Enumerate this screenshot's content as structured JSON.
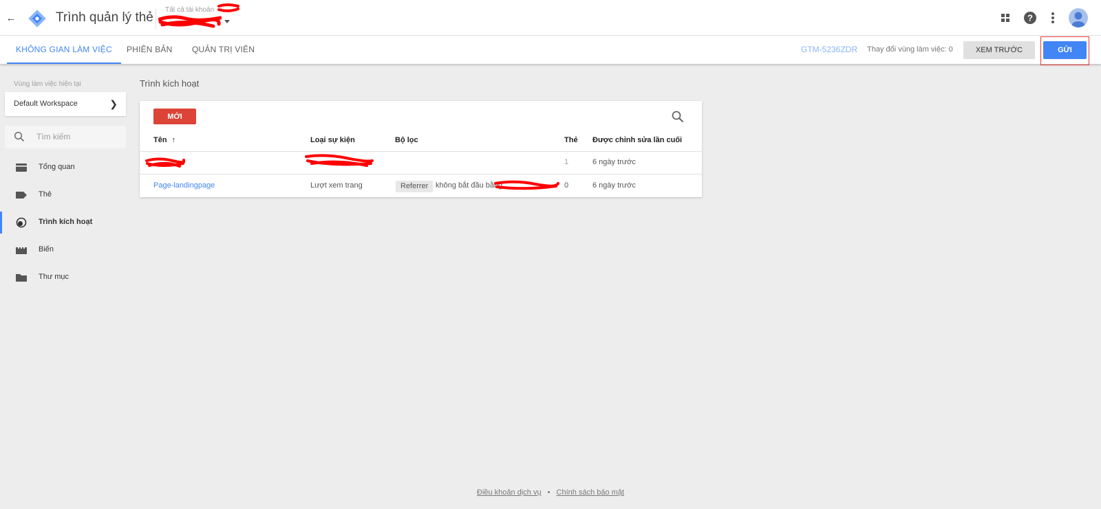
{
  "header": {
    "app_title": "Trình quản lý thẻ",
    "account_label": "Tất cả tài khoản",
    "icons": [
      "back-arrow-icon",
      "gtm-logo-icon",
      "apps-grid-icon",
      "help-icon",
      "more-vert-icon",
      "avatar-icon"
    ]
  },
  "tabs": [
    {
      "label": "KHÔNG GIAN LÀM VIỆC",
      "active": true
    },
    {
      "label": "PHIÊN BẢN",
      "active": false
    },
    {
      "label": "QUẢN TRỊ VIÊN",
      "active": false
    }
  ],
  "toolbar": {
    "container_id": "GTM-5236ZDR",
    "workspace_changes": "Thay đổi vùng làm việc: 0",
    "preview_label": "XEM TRƯỚC",
    "submit_label": "GỬI"
  },
  "sidebar": {
    "workspace_label": "Vùng làm việc hiện tại",
    "workspace_name": "Default Workspace",
    "search_placeholder": "Tìm kiếm",
    "items": [
      {
        "label": "Tổng quan",
        "icon": "overview-icon",
        "active": false
      },
      {
        "label": "Thẻ",
        "icon": "tag-icon",
        "active": false
      },
      {
        "label": "Trình kích hoạt",
        "icon": "trigger-icon",
        "active": true
      },
      {
        "label": "Biến",
        "icon": "variable-icon",
        "active": false
      },
      {
        "label": "Thư mục",
        "icon": "folder-icon",
        "active": false
      }
    ]
  },
  "main": {
    "heading": "Trình kích hoạt",
    "new_button": "MỚI",
    "table": {
      "columns": [
        "Tên",
        "Loại sự kiện",
        "Bộ lọc",
        "Thẻ",
        "Được chỉnh sửa lần cuối"
      ],
      "rows": [
        {
          "name": "",
          "event_type": "",
          "filter_chip": "",
          "filter_text": "",
          "tags": "1",
          "modified": "6 ngày trước"
        },
        {
          "name": "Page-landingpage",
          "event_type": "Lượt xem trang",
          "filter_chip": "Referrer",
          "filter_text": "không bắt đầu bằng",
          "tags": "0",
          "modified": "6 ngày trước"
        }
      ]
    }
  },
  "footer": {
    "terms": "Điều khoản dịch vụ",
    "separator": "•",
    "privacy": "Chính sách bảo mật"
  },
  "colors": {
    "accent": "#4285f4",
    "new_button": "#db4437",
    "highlight_box": "#e53935",
    "redaction": "#ff0000"
  }
}
